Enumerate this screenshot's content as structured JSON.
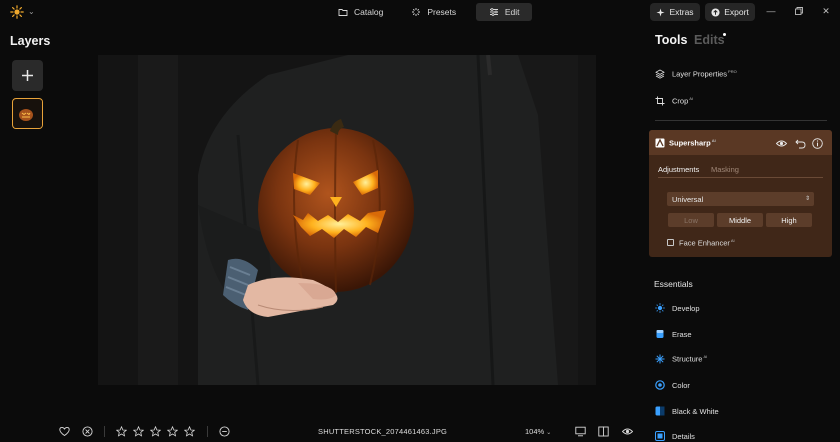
{
  "topbar": {
    "modes": [
      {
        "label": "Catalog",
        "icon": "folder-icon"
      },
      {
        "label": "Presets",
        "icon": "sparkle-icon"
      },
      {
        "label": "Edit",
        "icon": "sliders-icon"
      }
    ],
    "extras_label": "Extras",
    "export_label": "Export"
  },
  "layers": {
    "title": "Layers"
  },
  "tools_panel": {
    "tab_tools": "Tools",
    "tab_edits": "Edits",
    "top_tools": [
      {
        "label": "Layer Properties",
        "badge": "PRO",
        "icon": "layers-icon"
      },
      {
        "label": "Crop",
        "badge": "AI",
        "icon": "crop-icon"
      }
    ],
    "supersharp": {
      "title": "Supersharp",
      "badge": "AI",
      "tab_adjustments": "Adjustments",
      "tab_masking": "Masking",
      "mode_value": "Universal",
      "segments": [
        "Low",
        "Middle",
        "High"
      ],
      "face_enhancer_label": "Face Enhancer",
      "face_enhancer_badge": "AI"
    },
    "essentials_title": "Essentials",
    "essentials": [
      {
        "label": "Develop",
        "badge": "",
        "icon": "develop-icon",
        "color": "#3aa0ff"
      },
      {
        "label": "Erase",
        "badge": "",
        "icon": "eraser-icon",
        "color": "#3aa0ff"
      },
      {
        "label": "Structure",
        "badge": "AI",
        "icon": "structure-icon",
        "color": "#3aa0ff"
      },
      {
        "label": "Color",
        "badge": "",
        "icon": "color-icon",
        "color": "#3aa0ff"
      },
      {
        "label": "Black & White",
        "badge": "",
        "icon": "bw-icon",
        "color": "#3aa0ff"
      },
      {
        "label": "Details",
        "badge": "",
        "icon": "details-icon",
        "color": "#3aa0ff"
      }
    ]
  },
  "bottombar": {
    "filename": "SHUTTERSTOCK_2074461463.JPG",
    "zoom": "104%",
    "rating_stars": 5
  },
  "colors": {
    "accent_orange": "#e8a33a",
    "card_bg": "#402718",
    "card_header": "#5a3824",
    "essentials_blue": "#3aa0ff"
  }
}
